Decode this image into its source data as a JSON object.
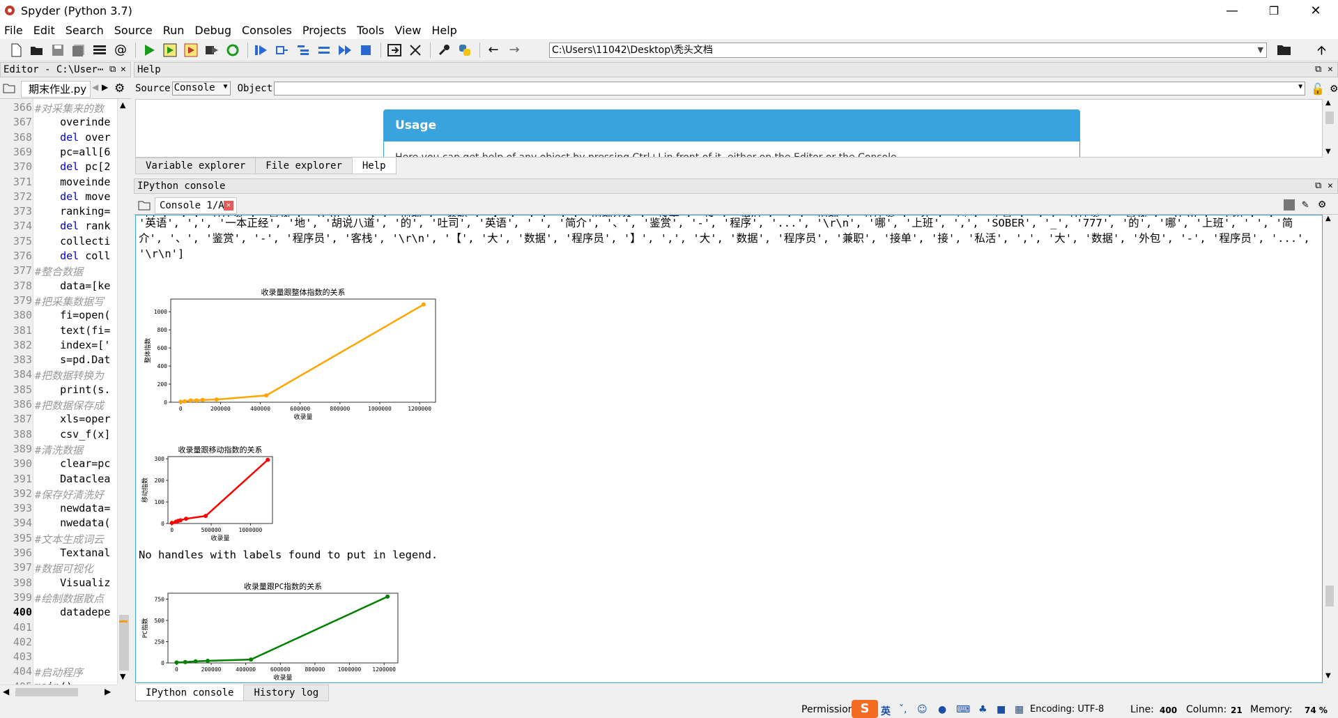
{
  "window": {
    "title": "Spyder (Python 3.7)",
    "minimize": "—",
    "maximize": "❐",
    "close": "✕"
  },
  "menu": [
    "File",
    "Edit",
    "Search",
    "Source",
    "Run",
    "Debug",
    "Consoles",
    "Projects",
    "Tools",
    "View",
    "Help"
  ],
  "toolbar": {
    "path": "C:\\Users\\11042\\Desktop\\秃头文档"
  },
  "editor": {
    "header": "Editor - C:\\User⋯",
    "tab": "期末作业.py",
    "lines": [
      {
        "n": "366",
        "t": "#对采集来的数",
        "c": "cm"
      },
      {
        "n": "367",
        "t": "    overinde",
        "c": ""
      },
      {
        "n": "368",
        "t": "    del over",
        "c": "kw"
      },
      {
        "n": "369",
        "t": "    pc=all[6",
        "c": ""
      },
      {
        "n": "370",
        "t": "    del pc[2",
        "c": "kw"
      },
      {
        "n": "371",
        "t": "    moveinde",
        "c": ""
      },
      {
        "n": "372",
        "t": "    del move",
        "c": "kw"
      },
      {
        "n": "373",
        "t": "    ranking=",
        "c": ""
      },
      {
        "n": "374",
        "t": "    del rank",
        "c": "kw"
      },
      {
        "n": "375",
        "t": "    collecti",
        "c": ""
      },
      {
        "n": "376",
        "t": "    del coll",
        "c": "kw"
      },
      {
        "n": "377",
        "t": "#整合数据",
        "c": "cm"
      },
      {
        "n": "378",
        "t": "    data=[ke",
        "c": ""
      },
      {
        "n": "379",
        "t": "#把采集数据写",
        "c": "cm"
      },
      {
        "n": "380",
        "t": "    fi=open(",
        "c": ""
      },
      {
        "n": "381",
        "t": "    text(fi=",
        "c": ""
      },
      {
        "n": "382",
        "t": "    index=['",
        "c": ""
      },
      {
        "n": "383",
        "t": "    s=pd.Dat",
        "c": ""
      },
      {
        "n": "384",
        "t": "#把数据转换为",
        "c": "cm"
      },
      {
        "n": "385",
        "t": "    print(s.",
        "c": ""
      },
      {
        "n": "386",
        "t": "#把数据保存成",
        "c": "cm"
      },
      {
        "n": "387",
        "t": "    xls=oper",
        "c": ""
      },
      {
        "n": "388",
        "t": "    csv_f(x]",
        "c": ""
      },
      {
        "n": "389",
        "t": "#清洗数据",
        "c": "cm"
      },
      {
        "n": "390",
        "t": "    clear=pc",
        "c": ""
      },
      {
        "n": "391",
        "t": "    Dataclea",
        "c": ""
      },
      {
        "n": "392",
        "t": "#保存好清洗好",
        "c": "cm"
      },
      {
        "n": "393",
        "t": "    newdata=",
        "c": ""
      },
      {
        "n": "394",
        "t": "    nwedata(",
        "c": ""
      },
      {
        "n": "395",
        "t": "#文本生成词云",
        "c": "cm"
      },
      {
        "n": "396",
        "t": "    Textanal",
        "c": ""
      },
      {
        "n": "397",
        "t": "#数据可视化",
        "c": "cm"
      },
      {
        "n": "398",
        "t": "    Visualiz",
        "c": ""
      },
      {
        "n": "399",
        "t": "#绘制数据散点",
        "c": "cm"
      },
      {
        "n": "400",
        "t": "    datadepe",
        "c": ""
      },
      {
        "n": "401",
        "t": "",
        "c": ""
      },
      {
        "n": "402",
        "t": "",
        "c": ""
      },
      {
        "n": "403",
        "t": "",
        "c": ""
      },
      {
        "n": "404",
        "t": "#启动程序",
        "c": "cm"
      },
      {
        "n": "405",
        "t": "main()",
        "c": ""
      }
    ],
    "current_line": "400"
  },
  "help": {
    "header": "Help",
    "source_label": "Source",
    "source_value": "Console",
    "object_label": "Object",
    "usage_title": "Usage",
    "usage_text": "Here you can get help of any object by pressing Ctrl+I in front of it, either on the Editor or the Console.",
    "tabs": [
      "Variable explorer",
      "File explorer",
      "Help"
    ]
  },
  "console": {
    "header": "IPython console",
    "tab": "Console 1/A",
    "text_top": "'英语', ',', '一本正经', '地', '胡说八道', '的', '吐司', '英语', ' ', '简介', '、', '鉴赏', '-', '程序', '...', '\\r\\n', '哪', '上班', ',', 'SOBER', '_', '777', '的', '哪', '上班', ' ', '简介', '、', '鉴赏', '-', '程序员', '客栈', '\\r\\n', '【', '大', '数据', '程序员', '】', ',', '大', '数据', '程序员', '兼职', '接单', '接', '私活', ',', '大', '数据', '外包', '-', '程序员', '...', '\\r\\n']",
    "legend_msg": "No handles with labels found to put in legend.",
    "bottom_tabs": [
      "IPython console",
      "History log"
    ]
  },
  "chart_data": [
    {
      "type": "line",
      "title": "收录量跟整体指数的关系",
      "xlabel": "收录量",
      "ylabel": "整体指数",
      "color": "#ffa500",
      "x": [
        0,
        20000,
        50000,
        80000,
        110000,
        180000,
        430000,
        1220000
      ],
      "y": [
        5,
        10,
        20,
        20,
        25,
        30,
        75,
        1080
      ],
      "xticks": [
        0,
        200000,
        400000,
        600000,
        800000,
        1000000,
        1200000
      ],
      "yticks": [
        0,
        200,
        400,
        600,
        800,
        1000
      ],
      "xlim": [
        -50000,
        1280000
      ],
      "ylim": [
        0,
        1140
      ]
    },
    {
      "type": "line",
      "title": "收录量跟移动指数的关系",
      "xlabel": "收录量",
      "ylabel": "移动指数",
      "color": "#ff0000",
      "x": [
        0,
        50000,
        80000,
        110000,
        180000,
        430000,
        1220000
      ],
      "y": [
        3,
        8,
        12,
        15,
        22,
        35,
        295
      ],
      "xticks": [
        0,
        500000,
        1000000
      ],
      "yticks": [
        0,
        100,
        200,
        300
      ],
      "xlim": [
        -50000,
        1280000
      ],
      "ylim": [
        0,
        310
      ]
    },
    {
      "type": "line",
      "title": "收录量跟PC指数的关系",
      "xlabel": "收录量",
      "ylabel": "PC指数",
      "color": "#008000",
      "x": [
        0,
        50000,
        110000,
        180000,
        430000,
        1220000
      ],
      "y": [
        5,
        10,
        18,
        25,
        40,
        780
      ],
      "xticks": [
        0,
        200000,
        400000,
        600000,
        800000,
        1000000,
        1200000
      ],
      "yticks": [
        0,
        250,
        500,
        750
      ],
      "xlim": [
        -50000,
        1280000
      ],
      "ylim": [
        0,
        820
      ]
    }
  ],
  "status": {
    "permissions": "Permissions:",
    "encoding": "Encoding: UTF-8",
    "line_label": "Line:",
    "line": "400",
    "column_label": "Column:",
    "column": "21",
    "memory_label": "Memory:",
    "memory": "74 %"
  },
  "ime": [
    "英",
    "ˇ,",
    "☺",
    "🎤",
    "⌨",
    "👕",
    "▦"
  ]
}
